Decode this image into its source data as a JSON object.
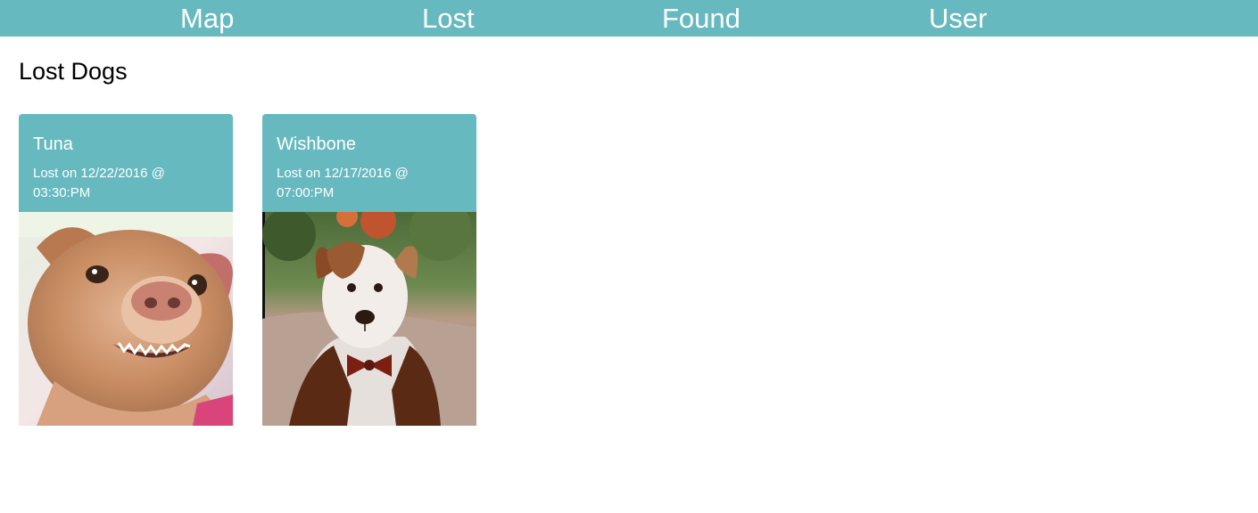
{
  "nav": {
    "items": [
      {
        "label": "Map"
      },
      {
        "label": "Lost"
      },
      {
        "label": "Found"
      },
      {
        "label": "User"
      }
    ]
  },
  "page": {
    "title": "Lost Dogs"
  },
  "colors": {
    "accent": "#67b9c0",
    "text_on_accent": "#ffffff"
  },
  "dogs": [
    {
      "name": "Tuna",
      "lost_text": "Lost on 12/22/2016 @ 03:30:PM",
      "photo": "dog-photo-tuna"
    },
    {
      "name": "Wishbone",
      "lost_text": "Lost on 12/17/2016 @ 07:00:PM",
      "photo": "dog-photo-wishbone"
    }
  ]
}
